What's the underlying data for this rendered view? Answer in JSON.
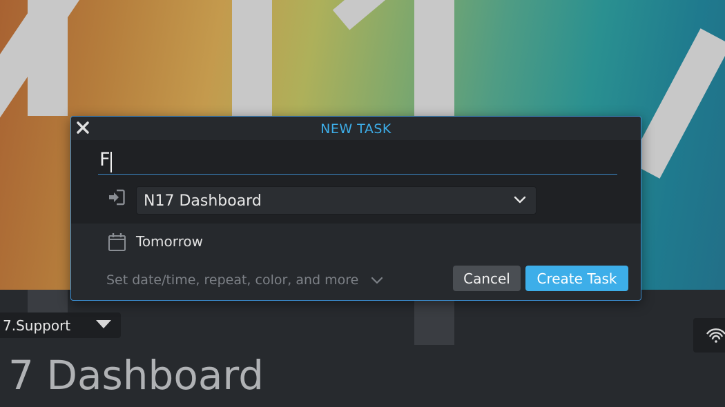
{
  "dialog": {
    "title": "NEW TASK",
    "task_title_value": "F",
    "project": "N17 Dashboard",
    "due_date": "Tomorrow",
    "more_options_label": "Set date/time, repeat, color, and more",
    "cancel_label": "Cancel",
    "create_label": "Create Task"
  },
  "background": {
    "project_selector": "7.Support",
    "page_heading": "7 Dashboard"
  },
  "icons": {
    "close": "close-icon",
    "project": "login-icon",
    "dropdown": "chevron-down-icon",
    "calendar": "calendar-icon",
    "more": "chevron-down-icon",
    "wifi": "wifi-icon"
  },
  "colors": {
    "accent": "#3daee9",
    "dialog_bg": "#26292d",
    "input_bg": "#1f2124",
    "cancel_bg": "#4a4e53"
  }
}
